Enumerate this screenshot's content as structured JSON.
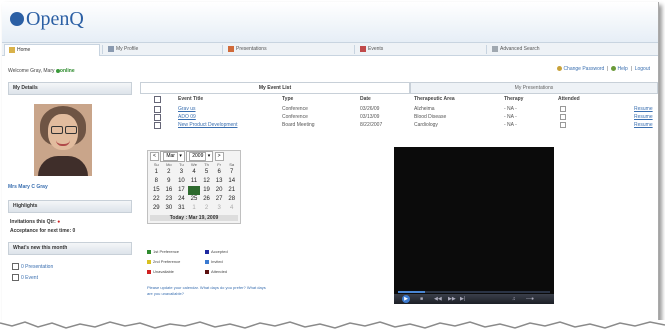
{
  "app": {
    "logo": "OpenQ"
  },
  "tabs": [
    {
      "label": "Home",
      "icon": "home-icon"
    },
    {
      "label": "My Profile",
      "icon": "profile-icon"
    },
    {
      "label": "Presentations",
      "icon": "presentation-icon"
    },
    {
      "label": "Events",
      "icon": "events-icon"
    },
    {
      "label": "Advanced Search",
      "icon": "search-icon"
    }
  ],
  "welcome": {
    "text": "Welcome Gray, Mary",
    "status": "online"
  },
  "toplinks": {
    "change_password": "Change Password",
    "help": "Help",
    "logout": "Logout"
  },
  "sidebar": {
    "details_header": "My Details",
    "name": "Mrs Mary C Gray",
    "highlights_header": "Highlights",
    "invitations": "Invitations this Qtr:",
    "acceptance": "Acceptance for next time: 0",
    "whats_new_header": "What's new this month",
    "new_presentation": "0 Presentation",
    "new_event": "0 Event"
  },
  "content_tabs": {
    "events": "My Event List",
    "presentations": "My Presentations"
  },
  "events": {
    "columns": [
      "Event Title",
      "Type",
      "Date",
      "Therapeutic Area",
      "Therapy",
      "Attended"
    ],
    "rows": [
      {
        "title": "Grav us",
        "type": "Conference",
        "date": "03/26/09",
        "area": "Alzheima",
        "therapy": "- NA -",
        "action": "Resume"
      },
      {
        "title": "ADO 09",
        "type": "Conference",
        "date": "03/13/09",
        "area": "Blood Disease",
        "therapy": "- NA -",
        "action": "Resume"
      },
      {
        "title": "New Product Development",
        "type": "Board Meeting",
        "date": "8/22/2007",
        "area": "Cardiology",
        "therapy": "- NA -",
        "action": "Resume"
      }
    ]
  },
  "calendar": {
    "month": "Mar",
    "year": "2009",
    "day_names": [
      "Su",
      "Mo",
      "Tu",
      "We",
      "Th",
      "Fr",
      "Sa"
    ],
    "weeks": [
      [
        "1",
        "2",
        "3",
        "4",
        "5",
        "6",
        "7"
      ],
      [
        "8",
        "9",
        "10",
        "11",
        "12",
        "13",
        "14"
      ],
      [
        "15",
        "16",
        "17",
        "18",
        "19",
        "20",
        "21"
      ],
      [
        "22",
        "23",
        "24",
        "25",
        "26",
        "27",
        "28"
      ],
      [
        "29",
        "30",
        "31",
        "1",
        "2",
        "3",
        "4"
      ]
    ],
    "today_label": "Today : Mar 19, 2009"
  },
  "legend": [
    {
      "label": "1st Preference",
      "color": "#2e8b2e"
    },
    {
      "label": "Accepted",
      "color": "#1e2aa0"
    },
    {
      "label": "2nd Preference",
      "color": "#d8c020"
    },
    {
      "label": "Invited",
      "color": "#3a7ad0"
    },
    {
      "label": "Unavailable",
      "color": "#d02020"
    },
    {
      "label": "Attended",
      "color": "#5a1010"
    }
  ],
  "note": "Please update your calendar. What days do you prefer? What days are you unavailable?"
}
